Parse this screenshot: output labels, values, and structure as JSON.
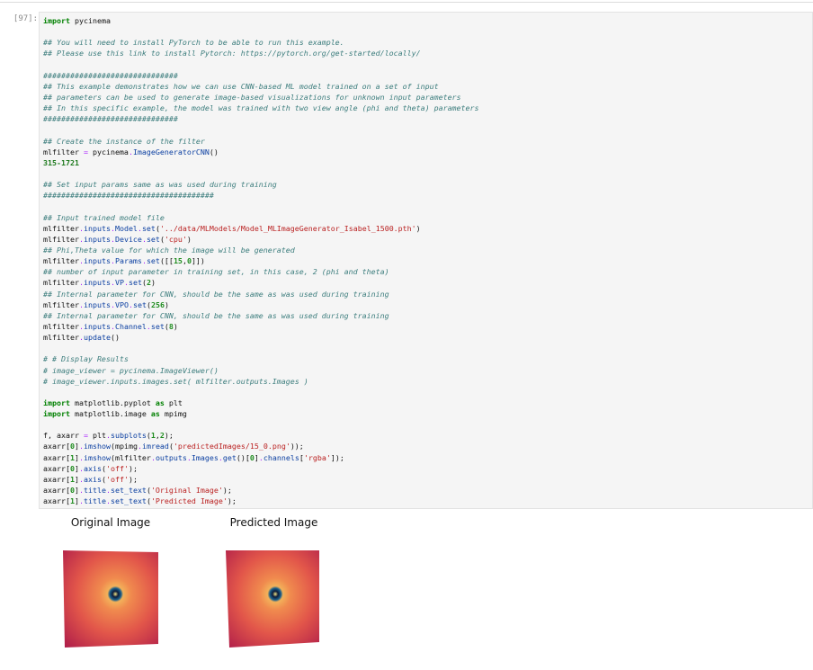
{
  "cell": {
    "prompt": "[97]:",
    "lines": [
      [
        [
          "kw",
          "import"
        ],
        [
          "tx",
          " pycinema"
        ]
      ],
      [],
      [
        [
          "cm",
          "## You will need to install PyTorch to be able to run this example."
        ]
      ],
      [
        [
          "cm",
          "## Please use this link to install Pytorch: https://pytorch.org/get-started/locally/"
        ]
      ],
      [],
      [
        [
          "cm",
          "##############################"
        ]
      ],
      [
        [
          "cm",
          "## This example demonstrates how we can use CNN-based ML model trained on a set of input"
        ]
      ],
      [
        [
          "cm",
          "## parameters can be used to generate image-based visualizations for unknown input parameters"
        ]
      ],
      [
        [
          "cm",
          "## In this specific example, the model was trained with two view angle (phi and theta) parameters"
        ]
      ],
      [
        [
          "cm",
          "##############################"
        ]
      ],
      [],
      [
        [
          "cm",
          "## Create the instance of the filter"
        ]
      ],
      [
        [
          "tx",
          "mlfilter "
        ],
        [
          "op",
          "="
        ],
        [
          "tx",
          " pycinema"
        ],
        [
          "op",
          "."
        ],
        [
          "fn",
          "ImageGeneratorCNN"
        ],
        [
          "tx",
          "()"
        ]
      ],
      [
        [
          "out",
          "315-1721"
        ]
      ],
      [],
      [
        [
          "cm",
          "## Set input params same as was used during training"
        ]
      ],
      [
        [
          "cm",
          "######################################"
        ]
      ],
      [],
      [
        [
          "cm",
          "## Input trained model file"
        ]
      ],
      [
        [
          "tx",
          "mlfilter"
        ],
        [
          "op",
          "."
        ],
        [
          "fn",
          "inputs"
        ],
        [
          "op",
          "."
        ],
        [
          "fn",
          "Model"
        ],
        [
          "op",
          "."
        ],
        [
          "fn",
          "set"
        ],
        [
          "tx",
          "("
        ],
        [
          "str",
          "'../data/MLModels/Model_MLImageGenerator_Isabel_1500.pth'"
        ],
        [
          "tx",
          ")"
        ]
      ],
      [
        [
          "tx",
          "mlfilter"
        ],
        [
          "op",
          "."
        ],
        [
          "fn",
          "inputs"
        ],
        [
          "op",
          "."
        ],
        [
          "fn",
          "Device"
        ],
        [
          "op",
          "."
        ],
        [
          "fn",
          "set"
        ],
        [
          "tx",
          "("
        ],
        [
          "str",
          "'cpu'"
        ],
        [
          "tx",
          ")"
        ]
      ],
      [
        [
          "cm",
          "## Phi,Theta value for which the image will be generated"
        ]
      ],
      [
        [
          "tx",
          "mlfilter"
        ],
        [
          "op",
          "."
        ],
        [
          "fn",
          "inputs"
        ],
        [
          "op",
          "."
        ],
        [
          "fn",
          "Params"
        ],
        [
          "op",
          "."
        ],
        [
          "fn",
          "set"
        ],
        [
          "tx",
          "([["
        ],
        [
          "num",
          "15"
        ],
        [
          "tx",
          ","
        ],
        [
          "num",
          "0"
        ],
        [
          "tx",
          "]])"
        ]
      ],
      [
        [
          "cm",
          "## number of input parameter in training set, in this case, 2 (phi and theta)"
        ]
      ],
      [
        [
          "tx",
          "mlfilter"
        ],
        [
          "op",
          "."
        ],
        [
          "fn",
          "inputs"
        ],
        [
          "op",
          "."
        ],
        [
          "fn",
          "VP"
        ],
        [
          "op",
          "."
        ],
        [
          "fn",
          "set"
        ],
        [
          "tx",
          "("
        ],
        [
          "num",
          "2"
        ],
        [
          "tx",
          ")"
        ]
      ],
      [
        [
          "cm",
          "## Internal parameter for CNN, should be the same as was used during training"
        ]
      ],
      [
        [
          "tx",
          "mlfilter"
        ],
        [
          "op",
          "."
        ],
        [
          "fn",
          "inputs"
        ],
        [
          "op",
          "."
        ],
        [
          "fn",
          "VPO"
        ],
        [
          "op",
          "."
        ],
        [
          "fn",
          "set"
        ],
        [
          "tx",
          "("
        ],
        [
          "num",
          "256"
        ],
        [
          "tx",
          ")"
        ]
      ],
      [
        [
          "cm",
          "## Internal parameter for CNN, should be the same as was used during training"
        ]
      ],
      [
        [
          "tx",
          "mlfilter"
        ],
        [
          "op",
          "."
        ],
        [
          "fn",
          "inputs"
        ],
        [
          "op",
          "."
        ],
        [
          "fn",
          "Channel"
        ],
        [
          "op",
          "."
        ],
        [
          "fn",
          "set"
        ],
        [
          "tx",
          "("
        ],
        [
          "num",
          "8"
        ],
        [
          "tx",
          ")"
        ]
      ],
      [
        [
          "tx",
          "mlfilter"
        ],
        [
          "op",
          "."
        ],
        [
          "fn",
          "update"
        ],
        [
          "tx",
          "()"
        ]
      ],
      [],
      [
        [
          "cm",
          "# # Display Results"
        ]
      ],
      [
        [
          "cm",
          "# image_viewer = pycinema.ImageViewer()"
        ]
      ],
      [
        [
          "cm",
          "# image_viewer.inputs.images.set( mlfilter.outputs.Images )"
        ]
      ],
      [],
      [
        [
          "kw",
          "import"
        ],
        [
          "tx",
          " matplotlib.pyplot "
        ],
        [
          "kw",
          "as"
        ],
        [
          "tx",
          " plt"
        ]
      ],
      [
        [
          "kw",
          "import"
        ],
        [
          "tx",
          " matplotlib.image "
        ],
        [
          "kw",
          "as"
        ],
        [
          "tx",
          " mpimg"
        ]
      ],
      [],
      [
        [
          "tx",
          "f, axarr "
        ],
        [
          "op",
          "="
        ],
        [
          "tx",
          " plt"
        ],
        [
          "op",
          "."
        ],
        [
          "fn",
          "subplots"
        ],
        [
          "tx",
          "("
        ],
        [
          "num",
          "1"
        ],
        [
          "tx",
          ","
        ],
        [
          "num",
          "2"
        ],
        [
          "tx",
          ");"
        ]
      ],
      [
        [
          "tx",
          "axarr["
        ],
        [
          "num",
          "0"
        ],
        [
          "tx",
          "]"
        ],
        [
          "op",
          "."
        ],
        [
          "fn",
          "imshow"
        ],
        [
          "tx",
          "(mpimg"
        ],
        [
          "op",
          "."
        ],
        [
          "fn",
          "imread"
        ],
        [
          "tx",
          "("
        ],
        [
          "str",
          "'predictedImages/15_0.png'"
        ],
        [
          "tx",
          "));"
        ]
      ],
      [
        [
          "tx",
          "axarr["
        ],
        [
          "num",
          "1"
        ],
        [
          "tx",
          "]"
        ],
        [
          "op",
          "."
        ],
        [
          "fn",
          "imshow"
        ],
        [
          "tx",
          "(mlfilter"
        ],
        [
          "op",
          "."
        ],
        [
          "fn",
          "outputs"
        ],
        [
          "op",
          "."
        ],
        [
          "fn",
          "Images"
        ],
        [
          "op",
          "."
        ],
        [
          "fn",
          "get"
        ],
        [
          "tx",
          "()["
        ],
        [
          "num",
          "0"
        ],
        [
          "tx",
          "]"
        ],
        [
          "op",
          "."
        ],
        [
          "fn",
          "channels"
        ],
        [
          "tx",
          "["
        ],
        [
          "str",
          "'rgba'"
        ],
        [
          "tx",
          "]);"
        ]
      ],
      [
        [
          "tx",
          "axarr["
        ],
        [
          "num",
          "0"
        ],
        [
          "tx",
          "]"
        ],
        [
          "op",
          "."
        ],
        [
          "fn",
          "axis"
        ],
        [
          "tx",
          "("
        ],
        [
          "str",
          "'off'"
        ],
        [
          "tx",
          ");"
        ]
      ],
      [
        [
          "tx",
          "axarr["
        ],
        [
          "num",
          "1"
        ],
        [
          "tx",
          "]"
        ],
        [
          "op",
          "."
        ],
        [
          "fn",
          "axis"
        ],
        [
          "tx",
          "("
        ],
        [
          "str",
          "'off'"
        ],
        [
          "tx",
          ");"
        ]
      ],
      [
        [
          "tx",
          "axarr["
        ],
        [
          "num",
          "0"
        ],
        [
          "tx",
          "]"
        ],
        [
          "op",
          "."
        ],
        [
          "fn",
          "title"
        ],
        [
          "op",
          "."
        ],
        [
          "fn",
          "set_text"
        ],
        [
          "tx",
          "("
        ],
        [
          "str",
          "'Original Image'"
        ],
        [
          "tx",
          ");"
        ]
      ],
      [
        [
          "tx",
          "axarr["
        ],
        [
          "num",
          "1"
        ],
        [
          "tx",
          "]"
        ],
        [
          "op",
          "."
        ],
        [
          "fn",
          "title"
        ],
        [
          "op",
          "."
        ],
        [
          "fn",
          "set_text"
        ],
        [
          "tx",
          "("
        ],
        [
          "str",
          "'Predicted Image'"
        ],
        [
          "tx",
          ");"
        ]
      ]
    ]
  },
  "output": {
    "left_title": "Original Image",
    "right_title": "Predicted Image",
    "colors": {
      "edge_dark": "#b01e4a",
      "mid_red": "#e2564a",
      "orange": "#f08a4e",
      "center_ring": "#1a5f8a",
      "center_dark": "#0b1b3a",
      "center_bright": "#f5e98a"
    }
  }
}
